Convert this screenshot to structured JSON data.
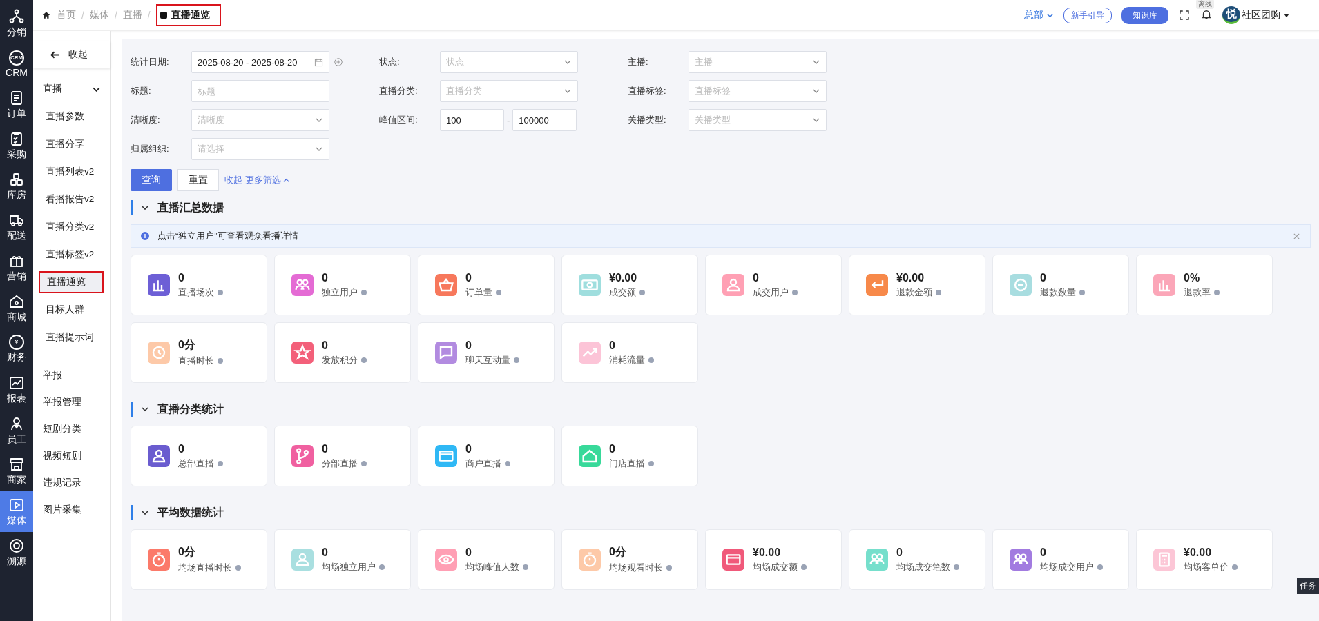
{
  "rail": [
    {
      "label": "分销",
      "selected": false
    },
    {
      "label": "CRM",
      "icon_text": "CRM",
      "selected": false
    },
    {
      "label": "订单",
      "selected": false
    },
    {
      "label": "采购",
      "selected": false
    },
    {
      "label": "库房",
      "selected": false
    },
    {
      "label": "配送",
      "selected": false
    },
    {
      "label": "营销",
      "selected": false
    },
    {
      "label": "商城",
      "selected": false
    },
    {
      "label": "财务",
      "icon_text": "¥",
      "selected": false
    },
    {
      "label": "报表",
      "selected": false
    },
    {
      "label": "员工",
      "selected": false
    },
    {
      "label": "商家",
      "selected": false
    },
    {
      "label": "媒体",
      "selected": true
    },
    {
      "label": "溯源",
      "selected": false
    }
  ],
  "breadcrumb_separator": "/",
  "breadcrumb": [
    {
      "label": "首页",
      "current": false
    },
    {
      "label": "媒体",
      "current": false
    },
    {
      "label": "直播",
      "current": false
    },
    {
      "label": "直播通览",
      "current": true
    }
  ],
  "header": {
    "org": "总部",
    "guide_button": "新手引导",
    "knowledge_button": "知识库",
    "status_badge": "离线",
    "avatar_text": "悦",
    "user": "社区团购"
  },
  "sidebar": {
    "collapse": "收起",
    "group": {
      "label": "直播",
      "expanded": true,
      "items": [
        {
          "label": "直播参数",
          "selected": false
        },
        {
          "label": "直播分享",
          "selected": false
        },
        {
          "label": "直播列表v2",
          "selected": false
        },
        {
          "label": "看播报告v2",
          "selected": false
        },
        {
          "label": "直播分类v2",
          "selected": false
        },
        {
          "label": "直播标签v2",
          "selected": false
        },
        {
          "label": "直播通览",
          "selected": true
        },
        {
          "label": "目标人群",
          "selected": false
        },
        {
          "label": "直播提示词",
          "selected": false
        }
      ]
    },
    "items": [
      {
        "label": "举报"
      },
      {
        "label": "举报管理"
      },
      {
        "label": "短剧分类"
      },
      {
        "label": "视频短剧"
      },
      {
        "label": "违规记录"
      },
      {
        "label": "图片采集"
      }
    ]
  },
  "filters": [
    {
      "label": "统计日期:",
      "kind": "date",
      "value": "2025-08-20 - 2025-08-20"
    },
    {
      "label": "状态:",
      "kind": "select",
      "placeholder": "状态"
    },
    {
      "label": "主播:",
      "kind": "select",
      "placeholder": "主播"
    },
    {
      "label": "标题:",
      "kind": "input",
      "placeholder": "标题"
    },
    {
      "label": "直播分类:",
      "kind": "select",
      "placeholder": "直播分类"
    },
    {
      "label": "直播标签:",
      "kind": "select",
      "placeholder": "直播标签"
    },
    {
      "label": "清晰度:",
      "kind": "select",
      "placeholder": "清晰度"
    },
    {
      "label": "峰值区间:",
      "kind": "range",
      "from": "100",
      "separator": "-",
      "to": "100000"
    },
    {
      "label": "关播类型:",
      "kind": "select",
      "placeholder": "关播类型"
    },
    {
      "label": "归属组织:",
      "kind": "select",
      "placeholder": "请选择"
    }
  ],
  "actions": {
    "query": "查询",
    "reset": "重置",
    "collapse_link": "收起",
    "more_link": "更多筛选"
  },
  "sections": [
    {
      "title": "直播汇总数据",
      "expanded": true,
      "notice": "点击“独立用户”可查看观众看播详情",
      "cards": [
        {
          "value": "0",
          "label": "直播场次",
          "color": "#6d5fd6"
        },
        {
          "value": "0",
          "label": "独立用户",
          "color": "#e46bd4"
        },
        {
          "value": "0",
          "label": "订单量",
          "color": "#f7785c"
        },
        {
          "value": "¥0.00",
          "label": "成交额",
          "color": "#9fdede"
        },
        {
          "value": "0",
          "label": "成交用户",
          "color": "#ffa0b4"
        },
        {
          "value": "¥0.00",
          "label": "退款金额",
          "color": "#f7894a"
        },
        {
          "value": "0",
          "label": "退款数量",
          "color": "#a8dde0"
        },
        {
          "value": "0%",
          "label": "退款率",
          "color": "#fba6b8"
        },
        {
          "value": "0分",
          "label": "直播时长",
          "color": "#fdc9a8"
        },
        {
          "value": "0",
          "label": "发放积分",
          "color": "#f3607a"
        },
        {
          "value": "0",
          "label": "聊天互动量",
          "color": "#b28be0"
        },
        {
          "value": "0",
          "label": "消耗流量",
          "color": "#fcc4d7"
        }
      ]
    },
    {
      "title": "直播分类统计",
      "expanded": true,
      "cards": [
        {
          "value": "0",
          "label": "总部直播",
          "color": "#6a5ccf"
        },
        {
          "value": "0",
          "label": "分部直播",
          "color": "#f060a0"
        },
        {
          "value": "0",
          "label": "商户直播",
          "color": "#2fb8f5"
        },
        {
          "value": "0",
          "label": "门店直播",
          "color": "#38d99a"
        }
      ]
    },
    {
      "title": "平均数据统计",
      "expanded": true,
      "cards": [
        {
          "value": "0分",
          "label": "均场直播时长",
          "color": "#fb7a6a"
        },
        {
          "value": "0",
          "label": "均场独立用户",
          "color": "#a9dfe0"
        },
        {
          "value": "0",
          "label": "均场峰值人数",
          "color": "#ff9fb4"
        },
        {
          "value": "0分",
          "label": "均场观看时长",
          "color": "#fdc9a8"
        },
        {
          "value": "¥0.00",
          "label": "均场成交额",
          "color": "#f0597a"
        },
        {
          "value": "0",
          "label": "均场成交笔数",
          "color": "#76dfcc"
        },
        {
          "value": "0",
          "label": "均场成交用户",
          "color": "#a27be0"
        },
        {
          "value": "¥0.00",
          "label": "均场客单价",
          "color": "#fcc6d6"
        }
      ]
    }
  ],
  "side_tab": "任务"
}
